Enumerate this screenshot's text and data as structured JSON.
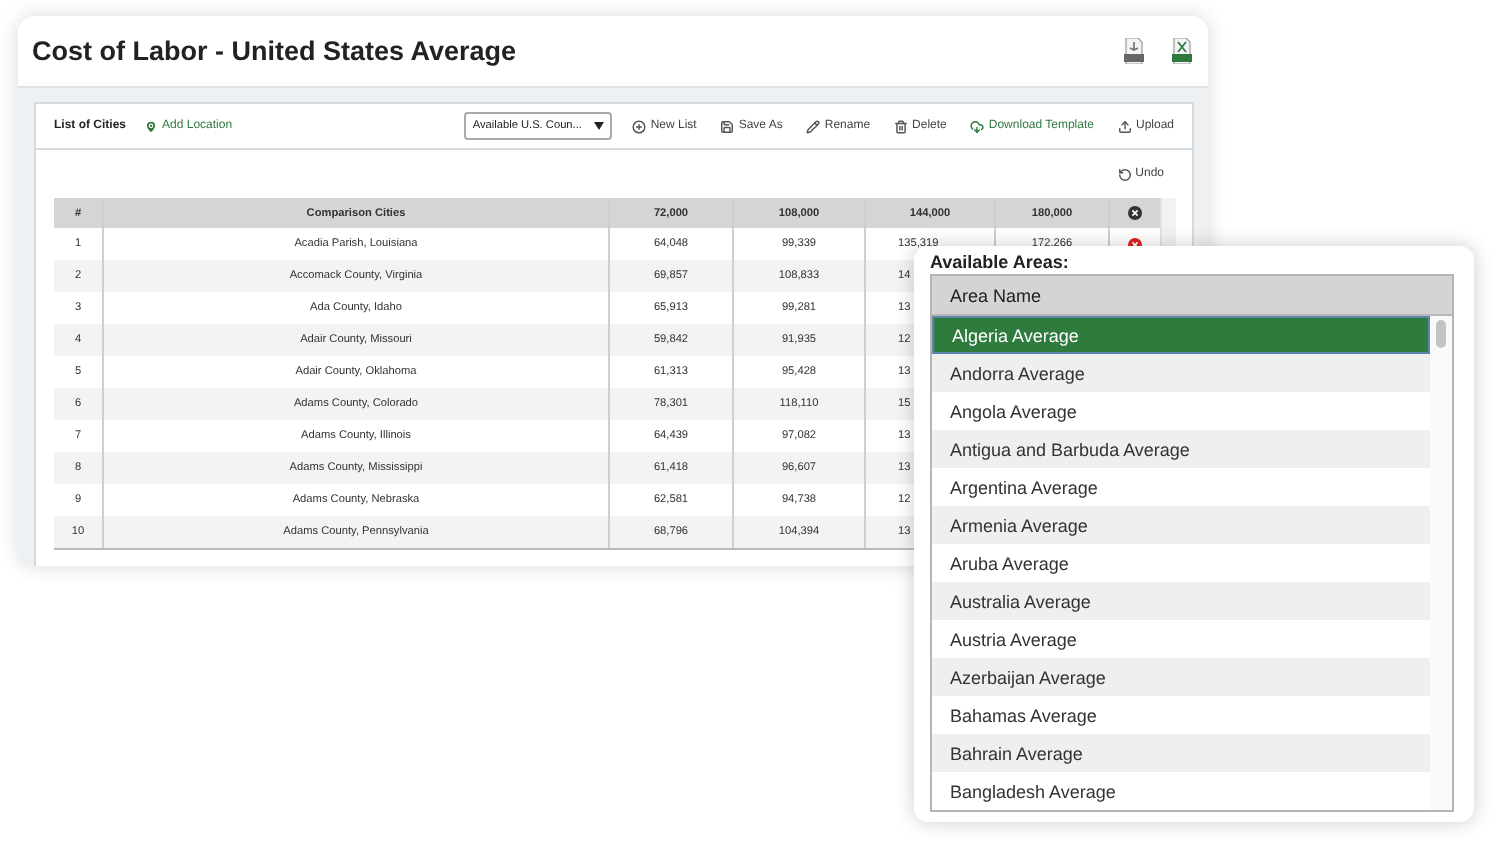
{
  "window": {
    "title": "Cost of Labor - United States Average"
  },
  "toolbar": {
    "label": "List of Cities",
    "add_location": "Add Location",
    "list_select": {
      "value": "Available U.S. Coun..."
    },
    "buttons": [
      {
        "label": "New List",
        "kind": "new"
      },
      {
        "label": "Save As",
        "kind": "save"
      },
      {
        "label": "Rename",
        "kind": "rename"
      },
      {
        "label": "Delete",
        "kind": "delete"
      },
      {
        "label": "Download Template",
        "kind": "download"
      },
      {
        "label": "Upload",
        "kind": "upload"
      }
    ]
  },
  "undo": "Undo",
  "table": {
    "columns": [
      "#",
      "Comparison Cities",
      "72,000",
      "108,000",
      "144,000",
      "180,000"
    ],
    "rows": [
      {
        "cells": [
          "1",
          "Acadia Parish, Louisiana",
          "64,048",
          "99,339",
          "135,319",
          "172,266"
        ]
      },
      {
        "cells": [
          "2",
          "Accomack County, Virginia",
          "69,857",
          "108,833",
          "14"
        ]
      },
      {
        "cells": [
          "3",
          "Ada County, Idaho",
          "65,913",
          "99,281",
          "13"
        ]
      },
      {
        "cells": [
          "4",
          "Adair County, Missouri",
          "59,842",
          "91,935",
          "12"
        ]
      },
      {
        "cells": [
          "5",
          "Adair County, Oklahoma",
          "61,313",
          "95,428",
          "13"
        ]
      },
      {
        "cells": [
          "6",
          "Adams County, Colorado",
          "78,301",
          "118,110",
          "15"
        ]
      },
      {
        "cells": [
          "7",
          "Adams County, Illinois",
          "64,439",
          "97,082",
          "13"
        ]
      },
      {
        "cells": [
          "8",
          "Adams County, Mississippi",
          "61,418",
          "96,607",
          "13"
        ]
      },
      {
        "cells": [
          "9",
          "Adams County, Nebraska",
          "62,581",
          "94,738",
          "12"
        ]
      },
      {
        "cells": [
          "10",
          "Adams County, Pennsylvania",
          "68,796",
          "104,394",
          "13"
        ]
      }
    ]
  },
  "areas_popup": {
    "title": "Available Areas:",
    "column": "Area Name",
    "items": [
      {
        "label": "Algeria Average",
        "selected": true
      },
      {
        "label": "Andorra Average",
        "selected": false
      },
      {
        "label": "Angola Average",
        "selected": false
      },
      {
        "label": "Antigua and Barbuda Average",
        "selected": false
      },
      {
        "label": "Argentina Average",
        "selected": false
      },
      {
        "label": "Armenia Average",
        "selected": false
      },
      {
        "label": "Aruba Average",
        "selected": false
      },
      {
        "label": "Australia Average",
        "selected": false
      },
      {
        "label": "Austria Average",
        "selected": false
      },
      {
        "label": "Azerbaijan Average",
        "selected": false
      },
      {
        "label": "Bahamas Average",
        "selected": false
      },
      {
        "label": "Bahrain Average",
        "selected": false
      },
      {
        "label": "Bangladesh Average",
        "selected": false
      }
    ]
  }
}
